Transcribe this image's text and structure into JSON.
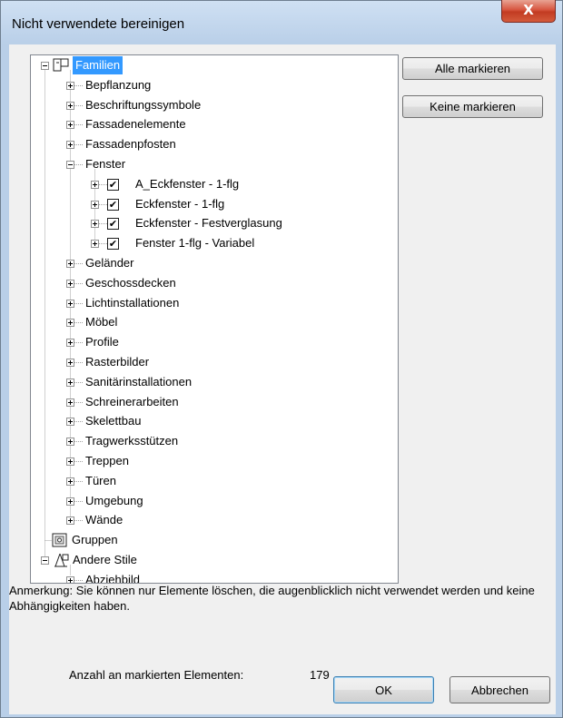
{
  "window": {
    "title": "Nicht verwendete bereinigen",
    "close_glyph": "X"
  },
  "tree": {
    "root": {
      "label": "Familien",
      "icon": "family-icon"
    },
    "categories_a": [
      "Bepflanzung",
      "Beschriftungssymbole",
      "Fassadenelemente",
      "Fassadenpfosten"
    ],
    "fenster": {
      "label": "Fenster",
      "items": [
        "A_Eckfenster - 1-flg",
        "Eckfenster - 1-flg",
        "Eckfenster - Festverglasung",
        "Fenster 1-flg - Variabel"
      ],
      "check_glyph": "✔"
    },
    "categories_b": [
      "Geländer",
      "Geschossdecken",
      "Lichtinstallationen",
      "Möbel",
      "Profile",
      "Rasterbilder",
      "Sanitärinstallationen",
      "Schreinerarbeiten",
      "Skelettbau",
      "Tragwerksstützen",
      "Treppen",
      "Türen",
      "Umgebung",
      "Wände"
    ],
    "gruppen": {
      "label": "Gruppen",
      "icon": "groups-icon"
    },
    "andere_stile": {
      "label": "Andere Stile",
      "icon": "styles-icon",
      "children": [
        "Abziehbild"
      ]
    }
  },
  "buttons": {
    "select_all": "Alle markieren",
    "select_none": "Keine markieren",
    "ok": "OK",
    "cancel": "Abbrechen"
  },
  "note": "Anmerkung: Sie können nur Elemente löschen, die augenblicklich nicht verwendet werden und keine Abhängigkeiten haben.",
  "count": {
    "label": "Anzahl an markierten Elementen:",
    "value": "179"
  }
}
